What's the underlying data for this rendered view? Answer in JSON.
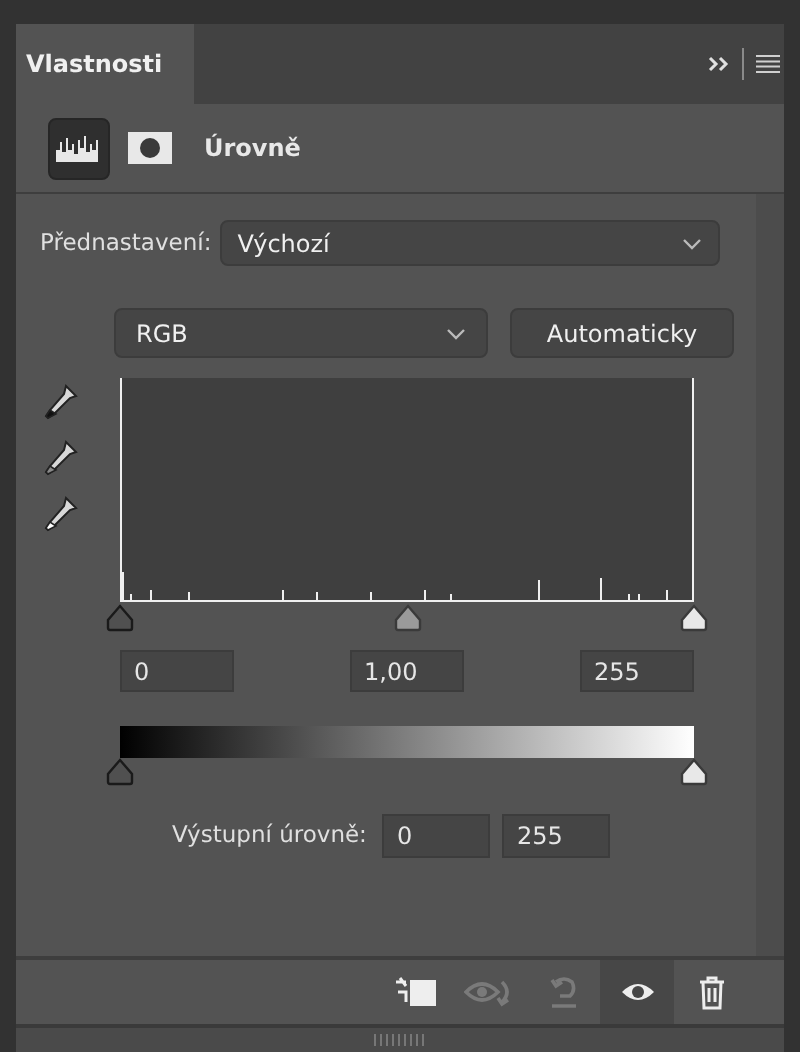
{
  "tab": {
    "label": "Vlastnosti",
    "selected": true
  },
  "header": {
    "icons": [
      {
        "kind": "adjustment",
        "selected": true
      },
      {
        "kind": "mask",
        "selected": false
      }
    ],
    "title": "Úrovně"
  },
  "preset": {
    "label": "Přednastavení:",
    "value": "Výchozí"
  },
  "channel": {
    "value": "RGB"
  },
  "auto_button": "Automaticky",
  "eyedroppers": [
    {
      "kind": "black"
    },
    {
      "kind": "gray"
    },
    {
      "kind": "white"
    }
  ],
  "input_sliders": [
    {
      "kind": "shadow",
      "level": 0
    },
    {
      "kind": "midtone",
      "level": 0.5
    },
    {
      "kind": "highlight",
      "level": 1
    }
  ],
  "input_fields": [
    "0",
    "1,00",
    "255"
  ],
  "output_sliders": [
    {
      "kind": "shadow",
      "level": 0
    },
    {
      "kind": "highlight",
      "level": 1
    }
  ],
  "output": {
    "label": "Výstupní úrovně:",
    "values": [
      "0",
      "255"
    ]
  },
  "toolbar": [
    {
      "kind": "clip",
      "disabled": false,
      "selected": false
    },
    {
      "kind": "view_previous",
      "disabled": true,
      "selected": false
    },
    {
      "kind": "reset",
      "disabled": true,
      "selected": false
    },
    {
      "kind": "visibility",
      "disabled": false,
      "selected": true
    },
    {
      "kind": "delete",
      "disabled": false,
      "selected": false
    }
  ]
}
